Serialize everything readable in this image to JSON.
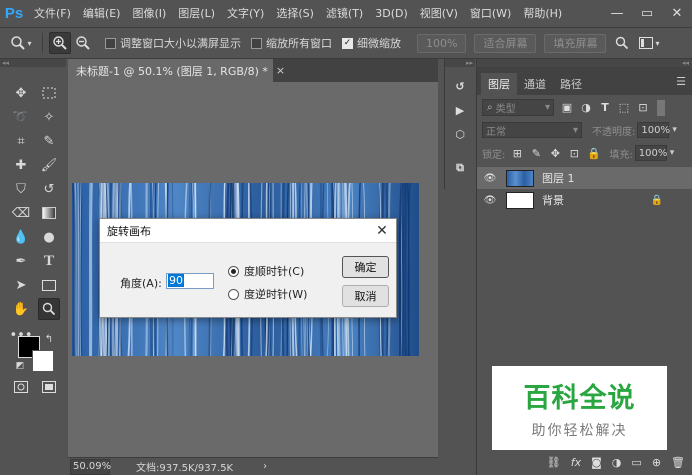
{
  "app": {
    "logo": "Ps"
  },
  "menu": [
    "文件(F)",
    "编辑(E)",
    "图像(I)",
    "图层(L)",
    "文字(Y)",
    "选择(S)",
    "滤镜(T)",
    "3D(D)",
    "视图(V)",
    "窗口(W)",
    "帮助(H)"
  ],
  "options": {
    "resize_windows": "调整窗口大小以满屏显示",
    "zoom_all": "缩放所有窗口",
    "scrubby_zoom": "细微缩放",
    "pct_btn": "100%",
    "fit_screen": "适合屏幕",
    "fill_screen": "填充屏幕"
  },
  "document": {
    "tab_title": "未标题-1 @ 50.1% (图层 1, RGB/8) *",
    "zoom": "50.09%",
    "info": "文档:937.5K/937.5K"
  },
  "dialog": {
    "title": "旋转画布",
    "angle_label": "角度(A):",
    "angle_value": "90",
    "cw": "度顺时针(C)",
    "ccw": "度逆时针(W)",
    "ok": "确定",
    "cancel": "取消"
  },
  "layers_panel": {
    "tabs": [
      "图层",
      "通道",
      "路径"
    ],
    "filter_kind": "类型",
    "blend_mode": "正常",
    "opacity_label": "不透明度:",
    "opacity_value": "100%",
    "lock_label": "锁定:",
    "fill_label": "填充:",
    "fill_value": "100%",
    "layers": [
      {
        "name": "图层 1",
        "selected": true
      },
      {
        "name": "背景",
        "selected": false
      }
    ]
  },
  "watermark": {
    "main": "百科全说",
    "sub": "助你轻松解决"
  },
  "colors": {
    "accent": "#31a8ff",
    "watermark_green": "#2aa641"
  }
}
